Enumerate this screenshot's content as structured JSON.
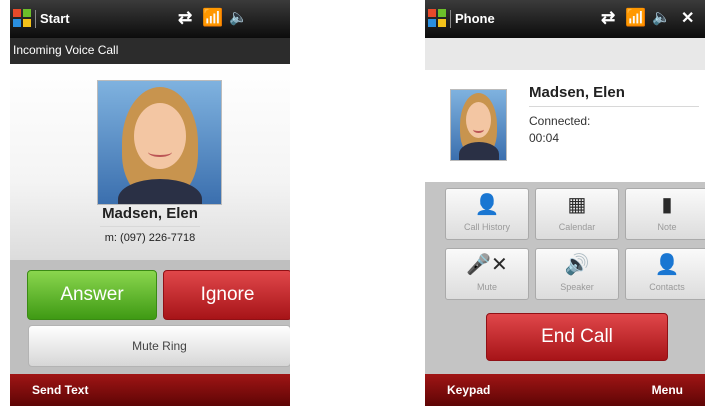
{
  "incoming_screen": {
    "title": "Start",
    "status_icons": [
      "sync-icon",
      "signal-icon",
      "speaker-icon"
    ],
    "header": "Incoming Voice Call",
    "contact_name": "Madsen, Elen",
    "contact_number": "m: (097) 226-7718",
    "answer_label": "Answer",
    "ignore_label": "Ignore",
    "mute_ring_label": "Mute Ring",
    "softkey_left": "Send Text",
    "colors": {
      "answer": "#4fa91d",
      "ignore": "#c41f22",
      "softbar": "#8b0e0e"
    }
  },
  "call_screen": {
    "title": "Phone",
    "status_icons": [
      "sync-icon",
      "signal-icon",
      "speaker-icon",
      "close-icon"
    ],
    "contact_name": "Madsen, Elen",
    "status_label": "Connected:",
    "call_timer": "00:04",
    "buttons": [
      {
        "label": "Call History",
        "icon": "call-history-icon"
      },
      {
        "label": "Calendar",
        "icon": "calendar-icon"
      },
      {
        "label": "Note",
        "icon": "note-icon"
      },
      {
        "label": "Mute",
        "icon": "mute-icon"
      },
      {
        "label": "Speaker",
        "icon": "speaker-icon"
      },
      {
        "label": "Contacts",
        "icon": "contacts-icon"
      }
    ],
    "end_call_label": "End Call",
    "softkey_left": "Keypad",
    "softkey_right": "Menu"
  }
}
